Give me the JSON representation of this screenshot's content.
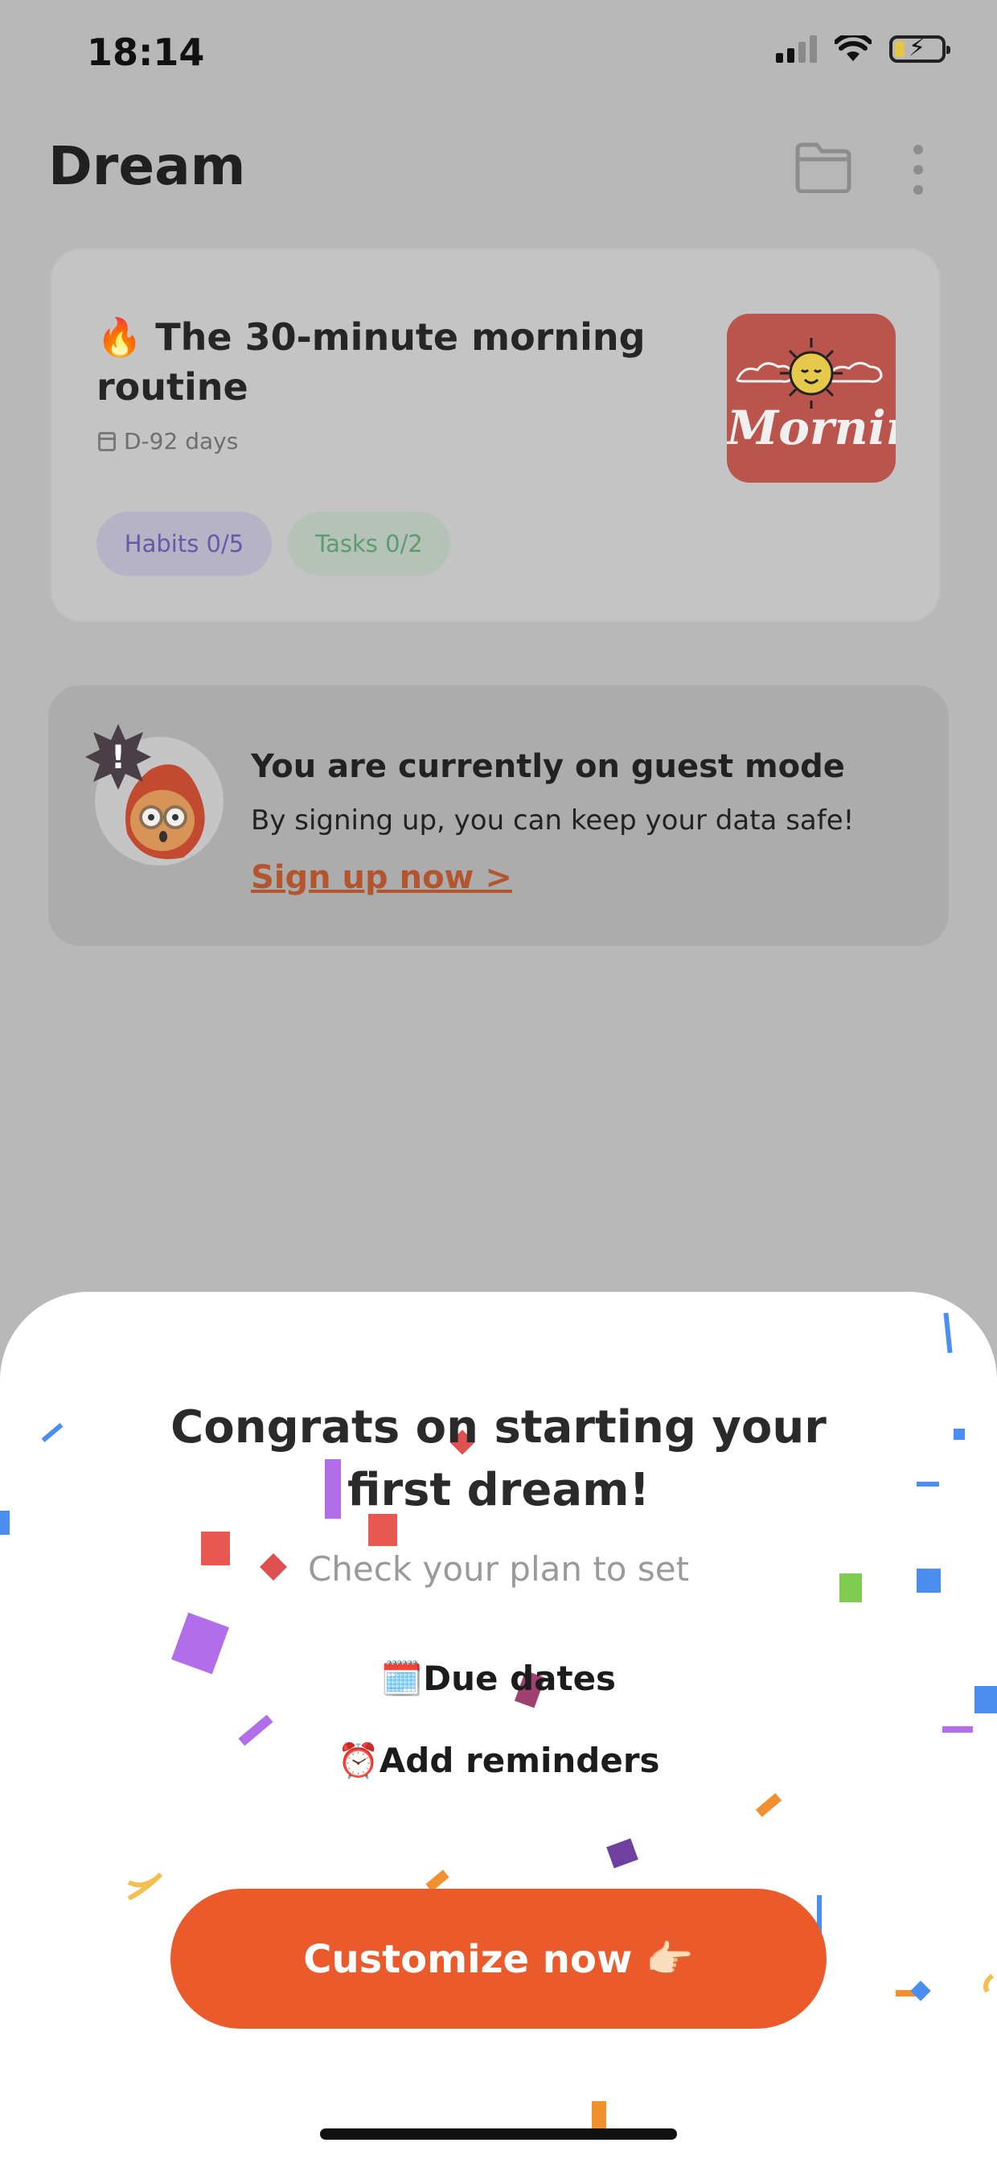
{
  "status_bar": {
    "time": "18:14"
  },
  "header": {
    "title": "Dream",
    "folder_icon": "folder-icon",
    "more_icon": "more-vertical-icon"
  },
  "dream_card": {
    "emoji": "🔥",
    "title": "The 30-minute morning routine",
    "due": "D-92 days",
    "thumbnail_text": "Morning",
    "habits_label": "Habits 0/5",
    "tasks_label": "Tasks 0/2",
    "colors": {
      "habits_text": "#6559a8",
      "tasks_text": "#5d9a6e",
      "thumb_bg": "#b9554c"
    }
  },
  "guest_banner": {
    "title": "You are currently on guest mode",
    "description": "By signing up, you can keep your data safe!",
    "link": "Sign up now >",
    "badge_text": "!"
  },
  "sheet": {
    "title": "Congrats on starting your first dream!",
    "subtitle": "Check your plan to set",
    "items": [
      {
        "emoji": "🗓️",
        "label": "Due dates"
      },
      {
        "emoji": "⏰",
        "label": "Add reminders"
      }
    ],
    "cta_label": "Customize now 👉🏻",
    "colors": {
      "cta": "#ea5a2b"
    }
  }
}
